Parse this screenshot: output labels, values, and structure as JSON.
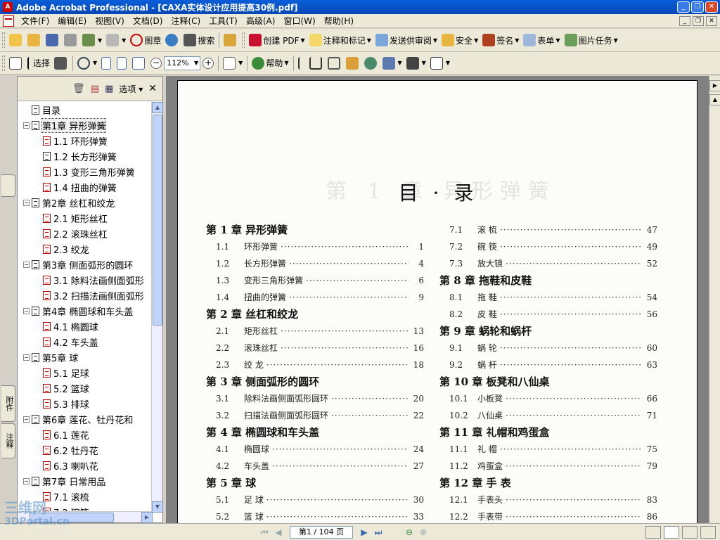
{
  "window": {
    "title": "Adobe Acrobat Professional - [CAXA实体设计应用提高30例.pdf]"
  },
  "menu": [
    "文件(F)",
    "编辑(E)",
    "视图(V)",
    "文档(D)",
    "注释(C)",
    "工具(T)",
    "高级(A)",
    "窗口(W)",
    "帮助(H)"
  ],
  "toolbar1": {
    "stamp_label": "图章",
    "search_label": "搜索",
    "create_pdf_label": "创建 PDF",
    "comment_label": "注释和标记",
    "send_review_label": "发送供审阅",
    "security_label": "安全",
    "sign_label": "签名",
    "forms_label": "表单",
    "image_tasks_label": "图片任务"
  },
  "toolbar2": {
    "select_label": "选择",
    "zoom_value": "112%",
    "help_label": "帮助"
  },
  "nav_panel": {
    "options_label": "选项",
    "tab_attach": "附件",
    "tab_comments": "注释",
    "bookmarks": [
      {
        "label": "目录",
        "level": 0,
        "expander": "",
        "type": "doc"
      },
      {
        "label": "第1章 异形弹簧",
        "level": 0,
        "expander": "−",
        "type": "doc",
        "selected": true
      },
      {
        "label": "1.1 环形弹簧",
        "level": 1,
        "type": "pdf"
      },
      {
        "label": "1.2 长方形弹簧",
        "level": 1,
        "type": "doc"
      },
      {
        "label": "1.3 变形三角形弹簧",
        "level": 1,
        "type": "pdf"
      },
      {
        "label": "1.4 扭曲的弹簧",
        "level": 1,
        "type": "pdf"
      },
      {
        "label": "第2章 丝杠和绞龙",
        "level": 0,
        "expander": "−",
        "type": "doc"
      },
      {
        "label": "2.1 矩形丝杠",
        "level": 1,
        "type": "pdf"
      },
      {
        "label": "2.2 滚珠丝杠",
        "level": 1,
        "type": "pdf"
      },
      {
        "label": "2.3 绞龙",
        "level": 1,
        "type": "pdf"
      },
      {
        "label": "第3章 侧面弧形的圆环",
        "level": 0,
        "expander": "−",
        "type": "doc"
      },
      {
        "label": "3.1 除料法画侧面弧形",
        "level": 1,
        "type": "pdf"
      },
      {
        "label": "3.2 扫描法画侧面弧形",
        "level": 1,
        "type": "pdf"
      },
      {
        "label": "第4章 椭圆球和车头盖",
        "level": 0,
        "expander": "−",
        "type": "doc"
      },
      {
        "label": "4.1 椭圆球",
        "level": 1,
        "type": "pdf"
      },
      {
        "label": "4.2 车头盖",
        "level": 1,
        "type": "pdf"
      },
      {
        "label": "第5章 球",
        "level": 0,
        "expander": "−",
        "type": "doc"
      },
      {
        "label": "5.1 足球",
        "level": 1,
        "type": "pdf"
      },
      {
        "label": "5.2 篮球",
        "level": 1,
        "type": "pdf"
      },
      {
        "label": "5.3 排球",
        "level": 1,
        "type": "pdf"
      },
      {
        "label": "第6章 莲花、牡丹花和",
        "level": 0,
        "expander": "−",
        "type": "doc"
      },
      {
        "label": "6.1 莲花",
        "level": 1,
        "type": "pdf"
      },
      {
        "label": "6.2 牡丹花",
        "level": 1,
        "type": "pdf"
      },
      {
        "label": "6.3 喇叭花",
        "level": 1,
        "type": "pdf"
      },
      {
        "label": "第7章 日常用品",
        "level": 0,
        "expander": "−",
        "type": "doc"
      },
      {
        "label": "7.1 滚梳",
        "level": 1,
        "type": "pdf"
      },
      {
        "label": "7.2 碗筷",
        "level": 1,
        "type": "pdf"
      }
    ]
  },
  "document": {
    "page_heading": "目 · 录",
    "ghost_heading": "第 1 章 异形弹簧",
    "left_column": [
      {
        "kind": "chapter",
        "text": "第 1 章   异形弹簧"
      },
      {
        "kind": "section",
        "num": "1.1",
        "name": "环形弹簧",
        "page": "1"
      },
      {
        "kind": "section",
        "num": "1.2",
        "name": "长方形弹簧",
        "page": "4"
      },
      {
        "kind": "section",
        "num": "1.3",
        "name": "变形三角形弹簧",
        "page": "6"
      },
      {
        "kind": "section",
        "num": "1.4",
        "name": "扭曲的弹簧",
        "page": "9"
      },
      {
        "kind": "chapter",
        "text": "第 2 章   丝杠和绞龙"
      },
      {
        "kind": "section",
        "num": "2.1",
        "name": "矩形丝杠",
        "page": "13"
      },
      {
        "kind": "section",
        "num": "2.2",
        "name": "滚珠丝杠",
        "page": "16"
      },
      {
        "kind": "section",
        "num": "2.3",
        "name": "绞  龙",
        "page": "18"
      },
      {
        "kind": "chapter",
        "text": "第 3 章   侧面弧形的圆环"
      },
      {
        "kind": "section",
        "num": "3.1",
        "name": "除料法画侧面弧形圆环",
        "page": "20"
      },
      {
        "kind": "section",
        "num": "3.2",
        "name": "扫描法画侧面弧形圆环",
        "page": "22"
      },
      {
        "kind": "chapter",
        "text": "第 4 章   椭圆球和车头盖"
      },
      {
        "kind": "section",
        "num": "4.1",
        "name": "椭圆球",
        "page": "24"
      },
      {
        "kind": "section",
        "num": "4.2",
        "name": "车头盖",
        "page": "27"
      },
      {
        "kind": "chapter",
        "text": "第 5 章   球"
      },
      {
        "kind": "section",
        "num": "5.1",
        "name": "足  球",
        "page": "30"
      },
      {
        "kind": "section",
        "num": "5.2",
        "name": "篮  球",
        "page": "33"
      }
    ],
    "right_column": [
      {
        "kind": "section",
        "num": "7.1",
        "name": "滚  梳",
        "page": "47"
      },
      {
        "kind": "section",
        "num": "7.2",
        "name": "碗  筷",
        "page": "49"
      },
      {
        "kind": "section",
        "num": "7.3",
        "name": "放大镜",
        "page": "52"
      },
      {
        "kind": "chapter",
        "text": "第 8 章   拖鞋和皮鞋"
      },
      {
        "kind": "section",
        "num": "8.1",
        "name": "拖  鞋",
        "page": "54"
      },
      {
        "kind": "section",
        "num": "8.2",
        "name": "皮  鞋",
        "page": "56"
      },
      {
        "kind": "chapter",
        "text": "第 9 章   蜗轮和蜗杆"
      },
      {
        "kind": "section",
        "num": "9.1",
        "name": "蜗  轮",
        "page": "60"
      },
      {
        "kind": "section",
        "num": "9.2",
        "name": "蜗  杆",
        "page": "63"
      },
      {
        "kind": "chapter",
        "text": "第 10 章   板凳和八仙桌"
      },
      {
        "kind": "section",
        "num": "10.1",
        "name": "小板凳",
        "page": "66"
      },
      {
        "kind": "section",
        "num": "10.2",
        "name": "八仙桌",
        "page": "71"
      },
      {
        "kind": "chapter",
        "text": "第 11 章   礼帽和鸡蛋盒"
      },
      {
        "kind": "section",
        "num": "11.1",
        "name": "礼  帽",
        "page": "75"
      },
      {
        "kind": "section",
        "num": "11.2",
        "name": "鸡蛋盒",
        "page": "79"
      },
      {
        "kind": "chapter",
        "text": "第 12 章   手  表"
      },
      {
        "kind": "section",
        "num": "12.1",
        "name": "手表头",
        "page": "83"
      },
      {
        "kind": "section",
        "num": "12.2",
        "name": "手表带",
        "page": "86"
      }
    ]
  },
  "status": {
    "page_indicator": "第1 / 104 页"
  },
  "watermark": {
    "line1": "三维网",
    "line2": "3DPortal.cn"
  },
  "colors": {
    "titlebar": "#0a5fd8",
    "chrome": "#ece9d8",
    "doc_bg": "#808080"
  }
}
